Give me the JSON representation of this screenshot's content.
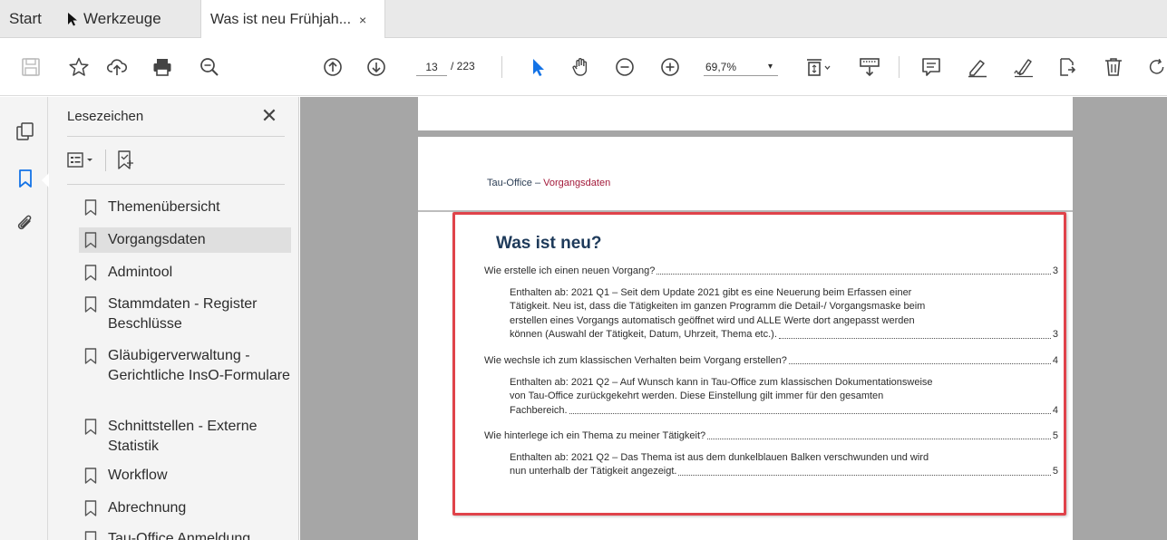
{
  "tabs": {
    "start": "Start",
    "tools": "Werkzeuge",
    "document": "Was ist neu Frühjah...",
    "close": "×"
  },
  "toolbar": {
    "page_current": "13",
    "page_total": "/ 223",
    "zoom": "69,7%",
    "zoom_caret": "▾",
    "icons": [
      "save-icon",
      "star-icon",
      "upload-cloud-icon",
      "print-icon",
      "zoom-search-icon",
      "page-up-icon",
      "page-down-icon",
      "select-arrow-icon",
      "hand-icon",
      "zoom-out-icon",
      "zoom-in-icon",
      "fit-page-icon",
      "scroll-mode-icon",
      "comment-icon",
      "highlight-pen-icon",
      "sign-icon",
      "share-icon",
      "delete-icon",
      "rotate-icon"
    ]
  },
  "panel": {
    "title": "Lesezeichen",
    "close": "✕",
    "bookmarks": [
      {
        "label": "Themenübersicht"
      },
      {
        "label": "Vorgangsdaten"
      },
      {
        "label": "Admintool"
      },
      {
        "label": "Stammdaten - Register Beschlüsse"
      },
      {
        "label": "Gläubigerverwaltung - Gerichtliche InsO-Formulare"
      },
      {
        "label": "Schnittstellen - Externe Statistik"
      },
      {
        "label": "Workflow"
      },
      {
        "label": "Abrechnung"
      },
      {
        "label": "Tau-Office Anmeldung"
      }
    ],
    "selected_index": 1
  },
  "document": {
    "header_main": "Tau-Office",
    "header_dash": " – ",
    "header_sub": "Vorgangsdaten",
    "toc_title": "Was ist neu?",
    "entries": [
      {
        "lines": [
          "Wie erstelle ich einen neuen Vorgang?"
        ],
        "page": "3",
        "indent": false
      },
      {
        "lines": [
          "Enthalten ab: 2021 Q1 – Seit dem Update 2021 gibt es eine Neuerung beim Erfassen einer",
          "Tätigkeit. Neu ist, dass die Tätigkeiten im ganzen Programm die Detail-/ Vorgangsmaske beim",
          "erstellen eines Vorgangs automatisch geöffnet wird und ALLE Werte dort angepasst werden",
          "können (Auswahl der Tätigkeit, Datum,  Uhrzeit, Thema etc.)."
        ],
        "page": "3",
        "indent": true
      },
      {
        "lines": [
          "Wie wechsle ich zum klassischen Verhalten beim Vorgang erstellen?"
        ],
        "page": "4",
        "indent": false
      },
      {
        "lines": [
          "Enthalten ab: 2021 Q2 – Auf Wunsch kann in Tau-Office zum klassischen Dokumentationsweise",
          "von Tau-Office zurückgekehrt werden. Diese Einstellung gilt immer für den gesamten",
          "Fachbereich."
        ],
        "page": "4",
        "indent": true
      },
      {
        "lines": [
          "Wie hinterlege ich ein Thema zu meiner Tätigkeit?"
        ],
        "page": "5",
        "indent": false
      },
      {
        "lines": [
          "Enthalten ab: 2021 Q2 – Das Thema ist aus dem dunkelblauen Balken verschwunden und wird",
          "nun unterhalb der Tätigkeit angezeigt."
        ],
        "page": "5",
        "indent": true
      }
    ]
  },
  "colors": {
    "highlight": "#e0434a",
    "toc_title": "#1e3a5a",
    "header_sub": "#a31a3a",
    "doc_bg": "#a6a6a6"
  }
}
